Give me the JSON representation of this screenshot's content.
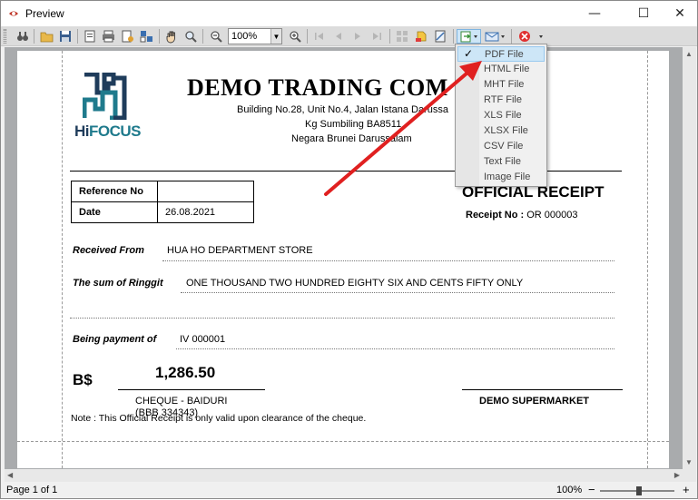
{
  "window": {
    "title": "Preview",
    "minimize_glyph": "—",
    "maximize_glyph": "☐",
    "close_glyph": "✕"
  },
  "toolbar": {
    "zoom_value": "100%"
  },
  "document": {
    "company_name": "DEMO TRADING COM",
    "address_line1": "Building  No.28, Unit No.4, Jalan Istana Darussa",
    "address_line2": "Kg Sumbiling  BA8511",
    "address_line3": "Negara Brunei  Darussalam",
    "logo_text_dark": "Hi",
    "logo_text_accent": "FOCUS",
    "reference_label": "Reference No",
    "reference_value": "",
    "date_label": "Date",
    "date_value": "26.08.2021",
    "receipt_title": "OFFICIAL RECEIPT",
    "receipt_no_label": "Receipt No :",
    "receipt_no_value": "OR 000003",
    "received_from_label": "Received From",
    "received_from_value": "HUA HO DEPARTMENT STORE",
    "sum_label": "The sum of Ringgit",
    "sum_value": "ONE THOUSAND TWO HUNDRED EIGHTY SIX AND CENTS FIFTY  ONLY",
    "payment_label": "Being payment of",
    "payment_value": "IV 000001",
    "currency": "B$",
    "amount": "1,286.50",
    "cheque_text": "CHEQUE - BAIDURI (BBB 334343)",
    "signatory": "DEMO SUPERMARKET",
    "note": "Note : This Official Receipt is only valid upon clearance of the cheque."
  },
  "export_menu": {
    "items": [
      {
        "label": "PDF File",
        "checked": true
      },
      {
        "label": "HTML File",
        "checked": false
      },
      {
        "label": "MHT File",
        "checked": false
      },
      {
        "label": "RTF File",
        "checked": false
      },
      {
        "label": "XLS File",
        "checked": false
      },
      {
        "label": "XLSX File",
        "checked": false
      },
      {
        "label": "CSV File",
        "checked": false
      },
      {
        "label": "Text File",
        "checked": false
      },
      {
        "label": "Image File",
        "checked": false
      }
    ]
  },
  "statusbar": {
    "page": "Page 1 of 1",
    "zoom": "100%",
    "zoom_out": "−",
    "zoom_in": "+"
  },
  "colors": {
    "annotation_arrow": "#e02020",
    "logo_dark": "#1f3c5b",
    "logo_accent": "#1f7a8c",
    "menu_highlight": "#cde6f7"
  }
}
